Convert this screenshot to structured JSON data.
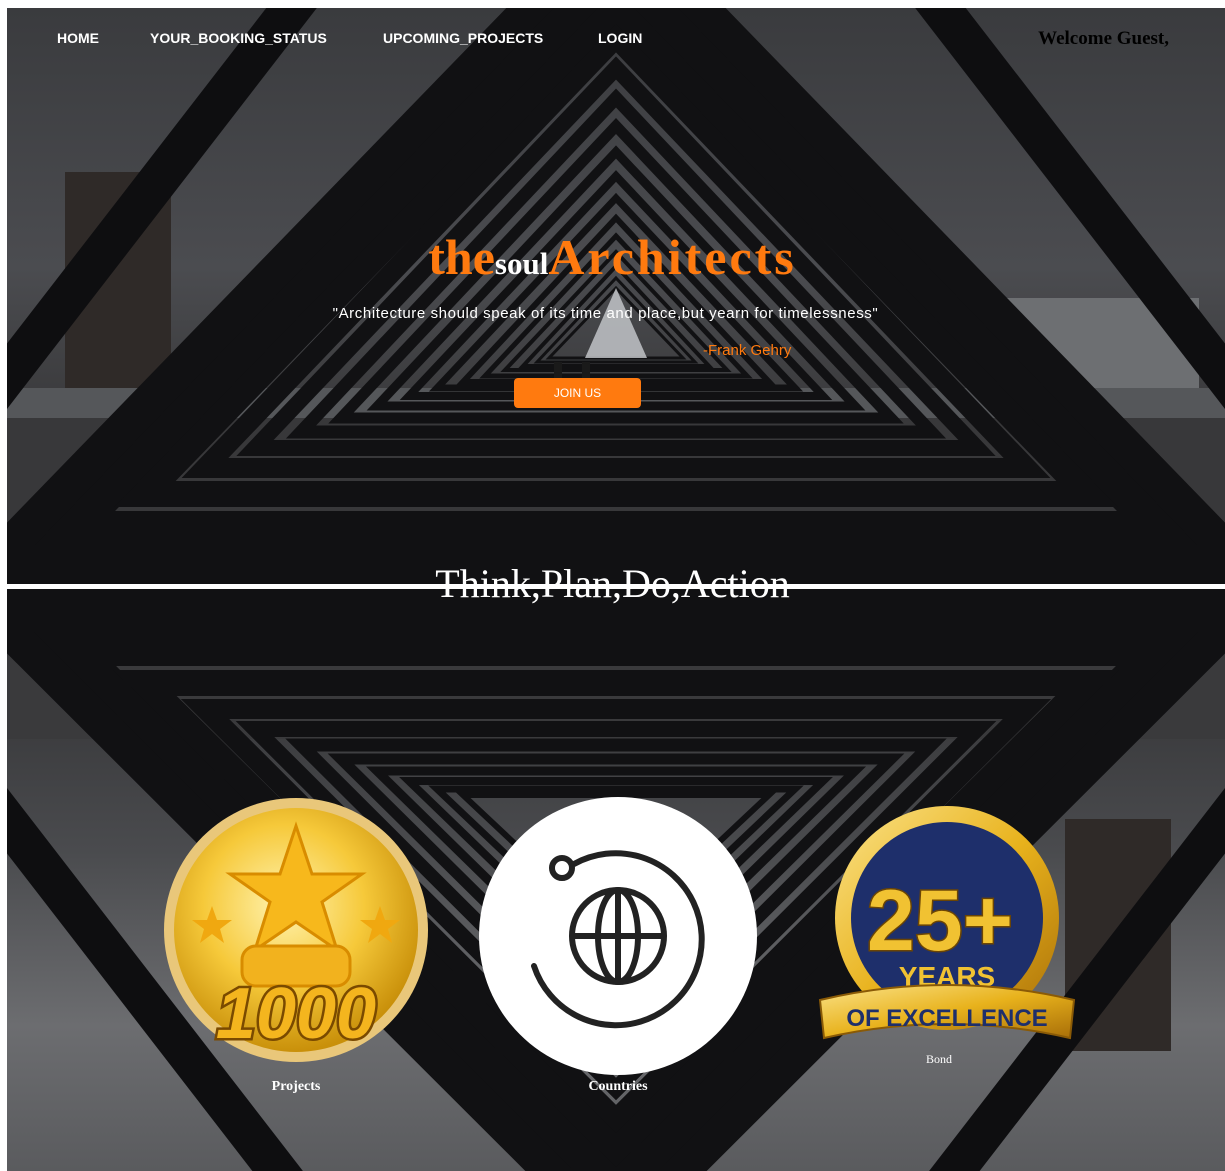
{
  "nav": {
    "items": [
      {
        "label": "HOME"
      },
      {
        "label": "YOUR_BOOKING_STATUS"
      },
      {
        "label": "UPCOMING_PROJECTS"
      },
      {
        "label": "LOGIN"
      }
    ],
    "welcome": "Welcome Guest,"
  },
  "hero": {
    "brand_the": "the",
    "brand_soul": "soul",
    "brand_architects": "Architects",
    "quote": "\"Architecture should speak of its time and place,but yearn for timelessness\"",
    "author": "-Frank Gehry",
    "join_label": "JOIN US"
  },
  "motto": "Think,Plan,Do,Action",
  "stats": [
    {
      "number": "1000",
      "label": "Projects",
      "icon": "gold-medal-icon"
    },
    {
      "number": "",
      "label": "Countries",
      "icon": "globe-icon"
    },
    {
      "number": "25+",
      "years": "YEARS",
      "ribbon": "OF EXCELLENCE",
      "label": "Bond",
      "icon": "excellence-badge-icon"
    }
  ],
  "colors": {
    "accent": "#ff7a0f",
    "text_light": "#ffffff",
    "text_dark": "#000000",
    "badge_navy": "#1e2f6b",
    "gold": "#e8b21c"
  }
}
